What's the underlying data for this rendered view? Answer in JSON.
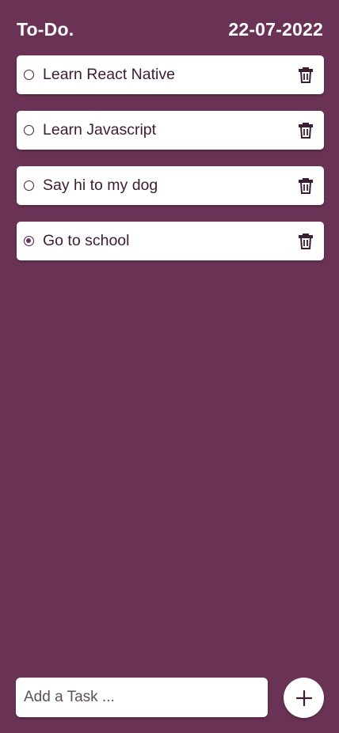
{
  "header": {
    "title": "To-Do.",
    "date": "22-07-2022"
  },
  "tasks": [
    {
      "label": "Learn React Native",
      "completed": false,
      "icon": "trash-icon"
    },
    {
      "label": "Learn Javascript",
      "completed": false,
      "icon": "trash-icon"
    },
    {
      "label": "Say hi to my dog",
      "completed": false,
      "icon": "trash-icon"
    },
    {
      "label": "Go to school",
      "completed": true,
      "icon": "trash-icon"
    }
  ],
  "composer": {
    "placeholder": "Add a Task ...",
    "add_icon": "plus-icon"
  },
  "colors": {
    "background": "#6a3356",
    "card": "#ffffff",
    "text": "#3c1d32"
  }
}
